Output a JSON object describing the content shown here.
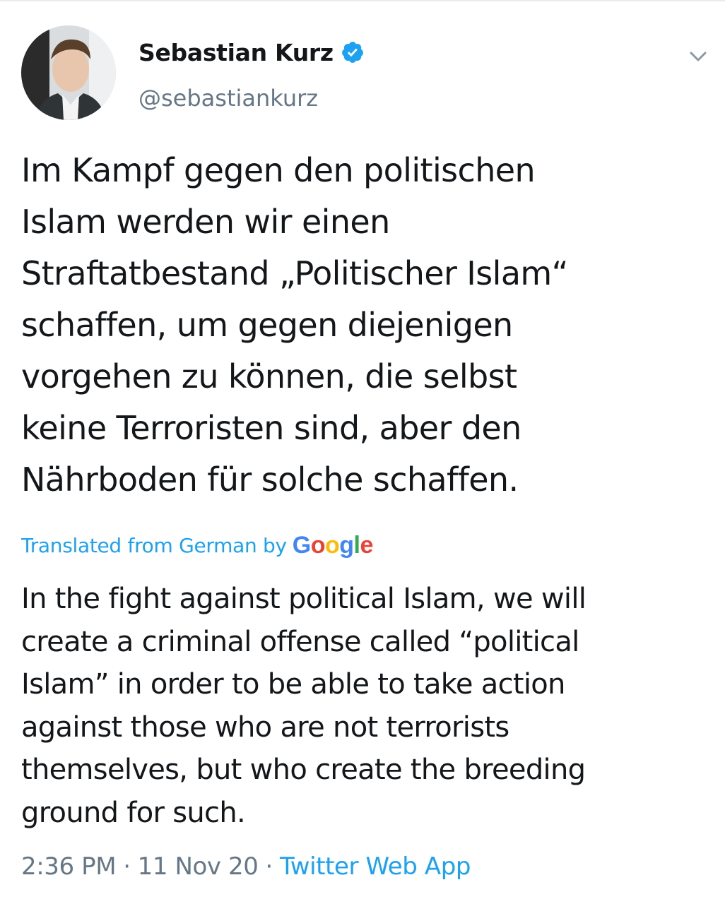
{
  "author": {
    "display_name": "Sebastian Kurz",
    "handle": "@sebastiankurz",
    "verified": true
  },
  "icons": {
    "verified": "verified-badge-icon",
    "menu": "chevron-down-icon"
  },
  "tweet": {
    "original_lines": [
      "Im Kampf gegen den politischen",
      "Islam werden wir einen",
      "Straftatbestand „Politischer Islam“",
      "schaffen, um gegen diejenigen",
      "vorgehen zu können, die selbst",
      "keine Terroristen sind, aber den",
      "Nährboden für solche schaffen."
    ],
    "translation_label": "Translated from German by",
    "translation_provider": "Google",
    "translated_lines": [
      "In the fight against political Islam, we will",
      "create a criminal offense called “political",
      "Islam” in order to be able to take action",
      "against those who are not terrorists",
      "themselves, but who create the breeding",
      "ground for such."
    ]
  },
  "meta": {
    "time": "2:36 PM",
    "separator": "·",
    "date": "11 Nov 20",
    "source": "Twitter Web App"
  },
  "colors": {
    "link": "#1da1f2",
    "secondary_text": "#657786",
    "primary_text": "#14171a",
    "google_blue": "#4285f4",
    "google_red": "#ea4335",
    "google_yellow": "#fbbc05",
    "google_green": "#34a853"
  }
}
